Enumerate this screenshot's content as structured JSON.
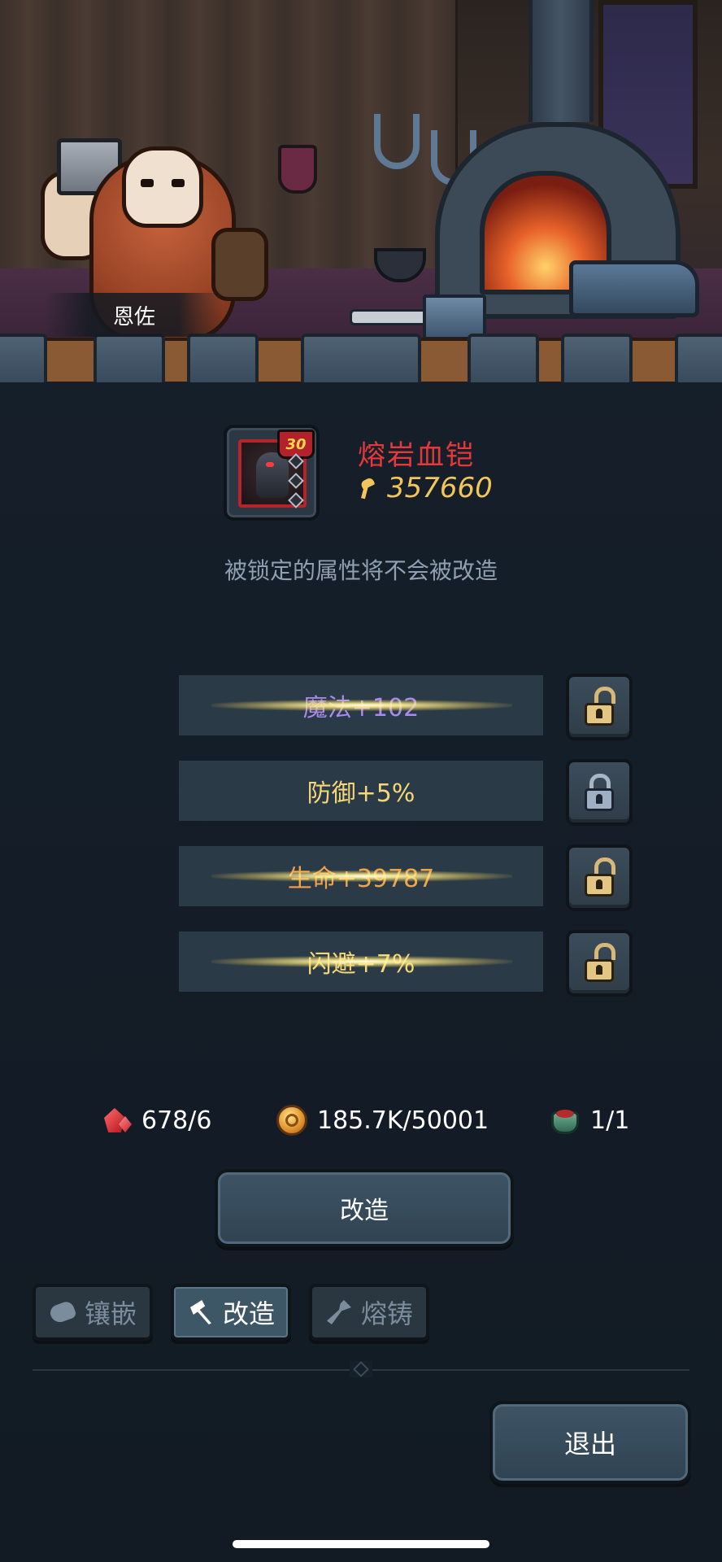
{
  "npc": {
    "name": "恩佐"
  },
  "item": {
    "name": "熔岩血铠",
    "level": "30",
    "power": "357660",
    "name_color": "#e6383a",
    "power_color": "#f2c65a"
  },
  "hint": "被锁定的属性将不会被改造",
  "attributes": [
    {
      "text": "魔法+102",
      "color": "#a98bf0",
      "locked": false,
      "flare": true
    },
    {
      "text": "防御+5%",
      "color": "#f3d779",
      "locked": true,
      "flare": false
    },
    {
      "text": "生命+39787",
      "color": "#f0a24a",
      "locked": false,
      "flare": true
    },
    {
      "text": "闪避+7%",
      "color": "#f3d779",
      "locked": false,
      "flare": true
    }
  ],
  "resources": {
    "crystal": {
      "icon": "red-crystal-icon",
      "value": "678/6"
    },
    "gold": {
      "icon": "gold-coin-icon",
      "value": "185.7K/50001"
    },
    "pot": {
      "icon": "forge-pot-icon",
      "value": "1/1"
    }
  },
  "actions": {
    "remake": "改造",
    "exit": "退出"
  },
  "tabs": [
    {
      "label": "镶嵌",
      "icon": "gem-icon",
      "active": false
    },
    {
      "label": "改造",
      "icon": "hammer-icon",
      "active": true
    },
    {
      "label": "熔铸",
      "icon": "smelt-icon",
      "active": false
    }
  ]
}
